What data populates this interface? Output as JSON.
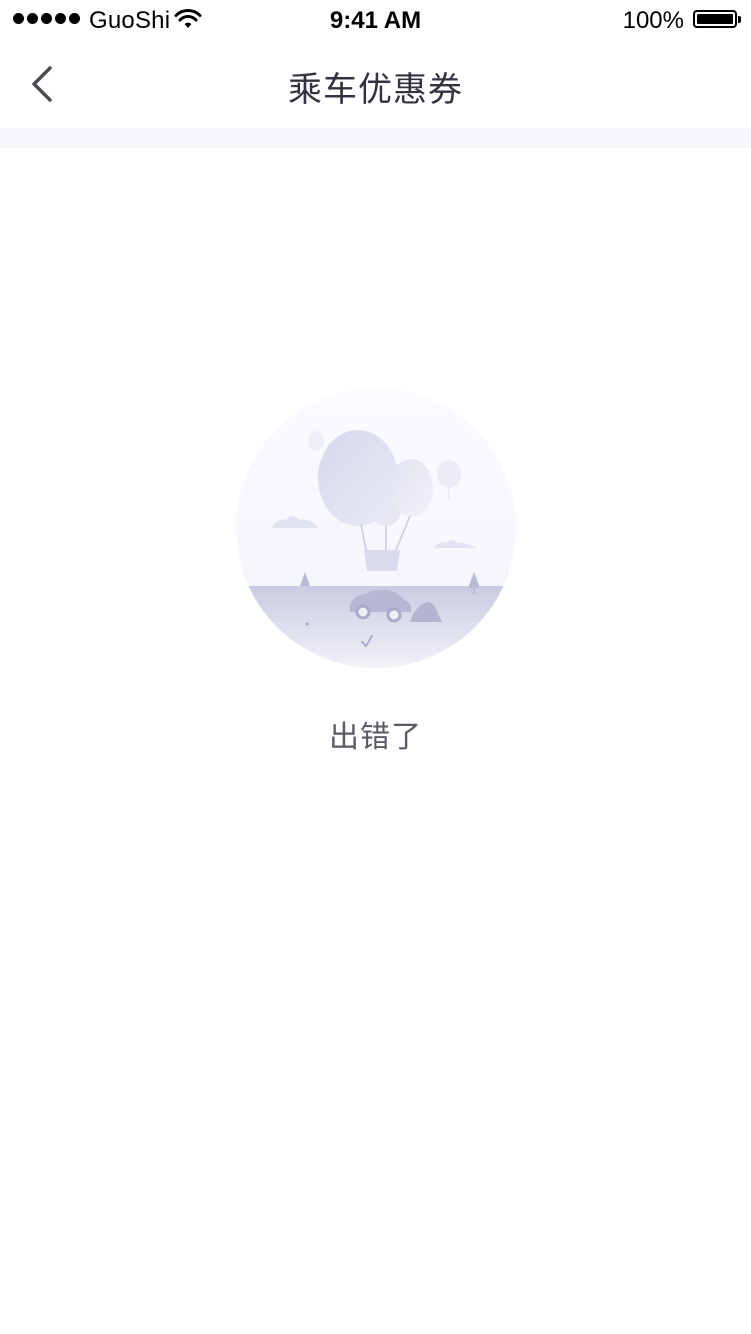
{
  "status_bar": {
    "carrier": "GuoShi",
    "time": "9:41 AM",
    "battery": "100%",
    "signal_icon": "signal-dots-icon",
    "wifi_icon": "wifi-icon",
    "battery_icon": "battery-icon"
  },
  "nav": {
    "title": "乘车优惠券",
    "back_icon": "chevron-left-icon"
  },
  "empty_state": {
    "illustration": "hot-air-balloon-illustration",
    "message": "出错了"
  },
  "colors": {
    "title_text": "#333340",
    "message_text": "#5b5d66",
    "band": "#f5f6fa",
    "illustration_tint": "#c9cbe3"
  }
}
